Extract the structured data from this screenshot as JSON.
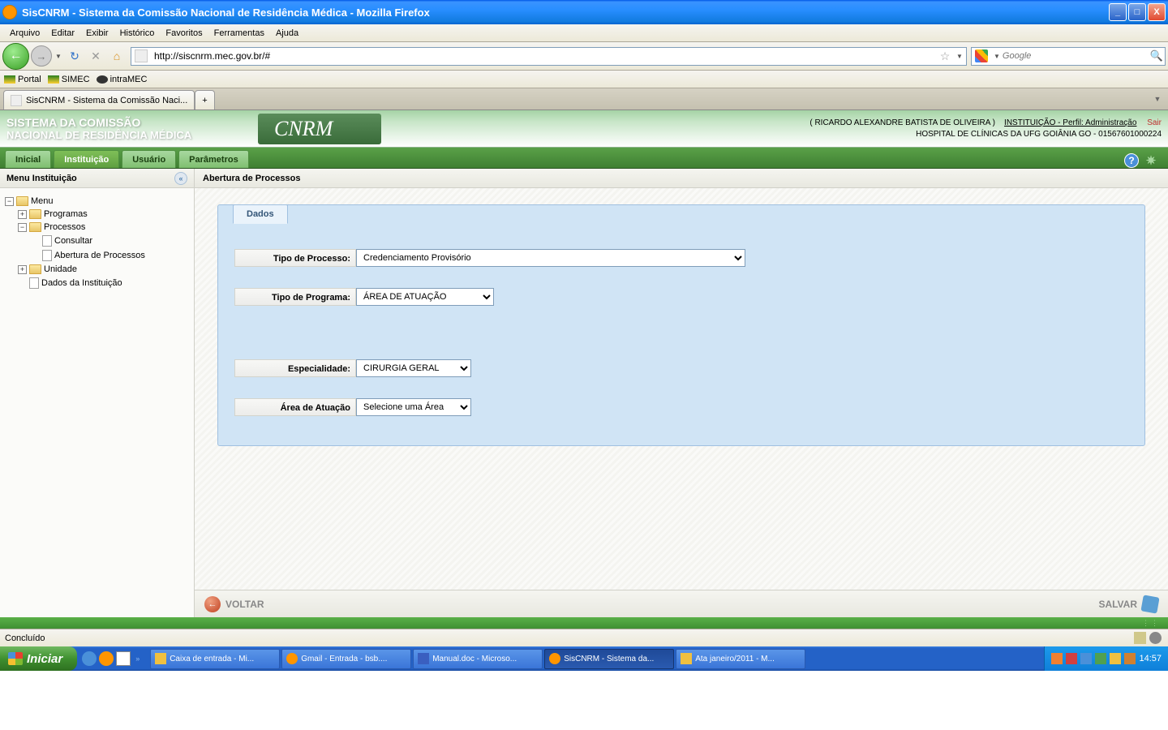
{
  "window": {
    "title": "SisCNRM - Sistema da Comissão Nacional de Residência Médica - Mozilla Firefox"
  },
  "menubar": {
    "arquivo": "Arquivo",
    "editar": "Editar",
    "exibir": "Exibir",
    "historico": "Histórico",
    "favoritos": "Favoritos",
    "ferramentas": "Ferramentas",
    "ajuda": "Ajuda"
  },
  "navbar": {
    "url": "http://siscnrm.mec.gov.br/#",
    "search_placeholder": "Google"
  },
  "bookmarks": {
    "portal": "Portal",
    "simec": "SIMEC",
    "intramec": "intraMEC"
  },
  "tabs": {
    "active": "SisCNRM - Sistema da Comissão Naci..."
  },
  "header": {
    "line1": "SISTEMA DA COMISSÃO",
    "line2": "NACIONAL DE RESIDÊNCIA MÉDICA",
    "brand": "CNRM",
    "user": "( RICARDO ALEXANDRE BATISTA DE OLIVEIRA )",
    "profile": "INSTITUIÇÃO - Perfil: Administração",
    "logout": "Sair",
    "institution": "HOSPITAL DE CLÍNICAS DA UFG GOIÂNIA GO - 01567601000224"
  },
  "apptabs": {
    "inicial": "Inicial",
    "instituicao": "Instituição",
    "usuario": "Usuário",
    "parametros": "Parâmetros"
  },
  "sidebar": {
    "title": "Menu Instituição",
    "menu": "Menu",
    "programas": "Programas",
    "processos": "Processos",
    "consultar": "Consultar",
    "abertura": "Abertura de Processos",
    "unidade": "Unidade",
    "dados": "Dados da Instituição"
  },
  "main": {
    "title": "Abertura de Processos",
    "section": "Dados",
    "labels": {
      "tipo_processo": "Tipo de Processo:",
      "tipo_programa": "Tipo de Programa:",
      "especialidade": "Especialidade:",
      "area": "Área de Atuação"
    },
    "values": {
      "tipo_processo": "Credenciamento Provisório",
      "tipo_programa": "ÁREA DE ATUAÇÃO",
      "especialidade": "CIRURGIA GERAL",
      "area": "Selecione uma Área"
    },
    "footer": {
      "voltar": "VOLTAR",
      "salvar": "SALVAR"
    }
  },
  "statusbar": {
    "text": "Concluído"
  },
  "taskbar": {
    "start": "Iniciar",
    "items": [
      "Caixa de entrada - Mi...",
      "Gmail - Entrada - bsb....",
      "Manual.doc - Microso...",
      "SisCNRM - Sistema da...",
      "Ata janeiro/2011 - M..."
    ],
    "time": "14:57"
  }
}
